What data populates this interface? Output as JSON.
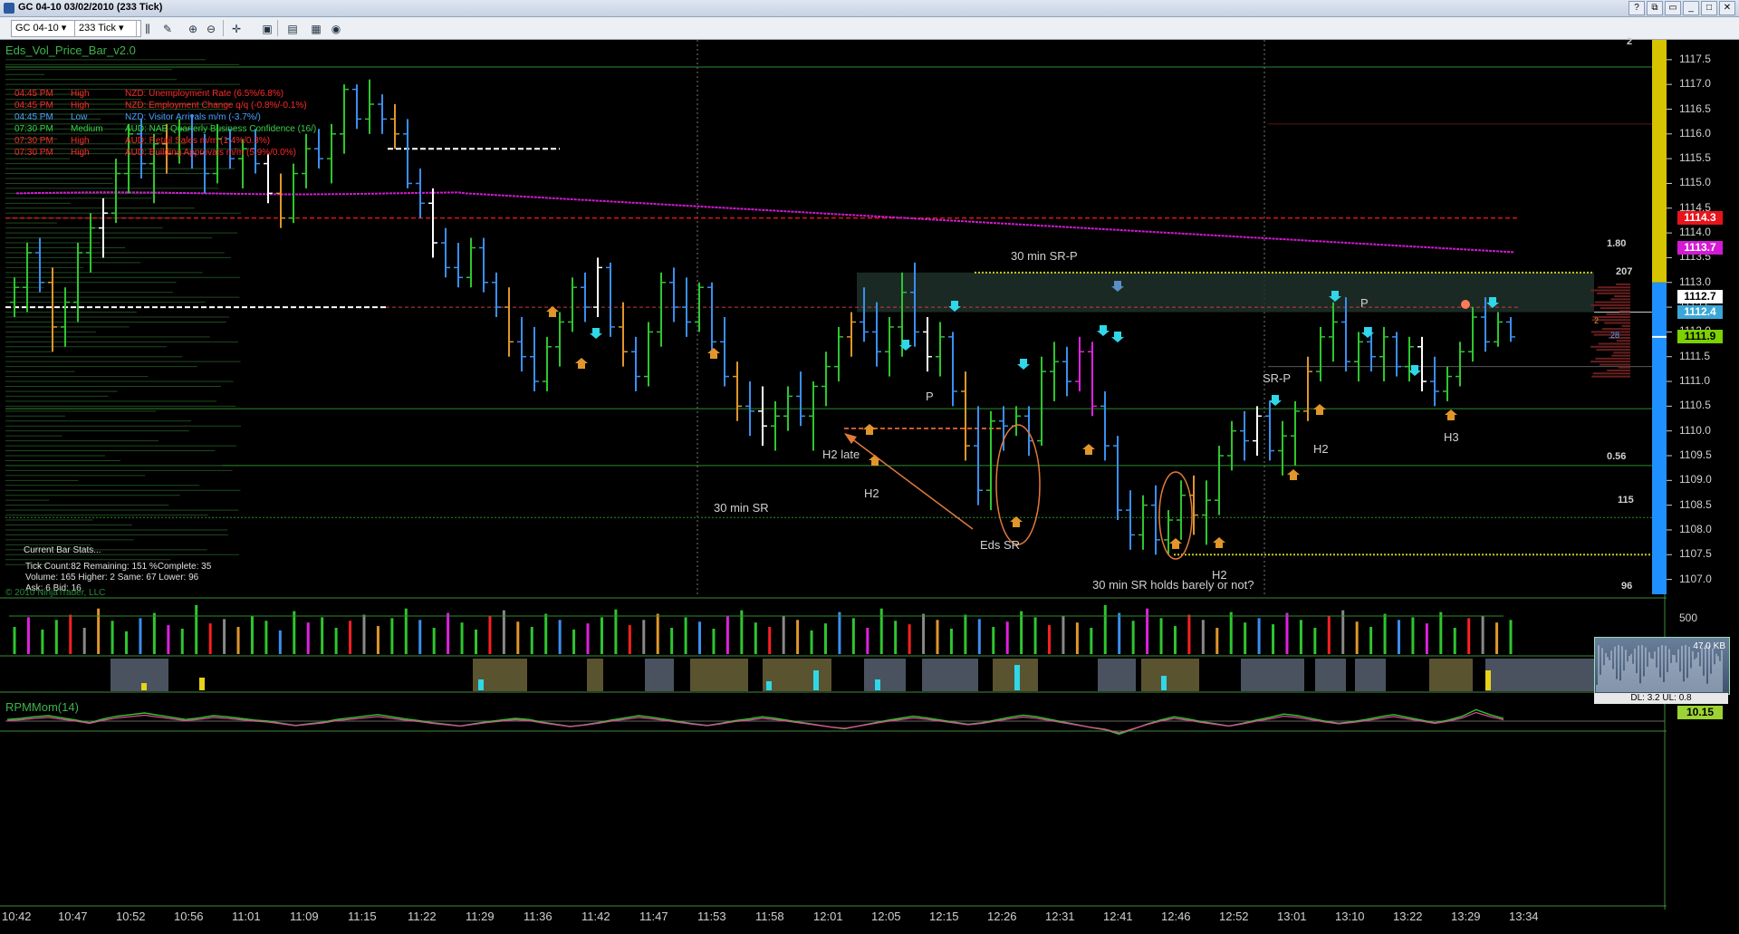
{
  "window": {
    "title": "GC 04-10  03/02/2010 (233 Tick)",
    "buttons": [
      "?",
      "⧉",
      "▭",
      "_",
      "□",
      "✕"
    ]
  },
  "toolbar": {
    "instrument": "GC 04-10",
    "interval": "233 Tick"
  },
  "indicators": {
    "top": "Eds_Vol_Price_Bar_v2.0",
    "bottom": "RPMMom(14)"
  },
  "news": [
    {
      "time": "04:45 PM",
      "impact": "High",
      "text": "NZD: Unemployment Rate (6.5%/6.8%)",
      "color": "#ff2a2a"
    },
    {
      "time": "04:45 PM",
      "impact": "High",
      "text": "NZD: Employment Change q/q (-0.8%/-0.1%)",
      "color": "#ff2a2a"
    },
    {
      "time": "04:45 PM",
      "impact": "Low",
      "text": "NZD: Visitor Arrivals m/m (-3.7%/)",
      "color": "#4aa3ff"
    },
    {
      "time": "07:30 PM",
      "impact": "Medium",
      "text": "AUD: NAB Quarterly Business Confidence (16/)",
      "color": "#39d24a"
    },
    {
      "time": "07:30 PM",
      "impact": "High",
      "text": "AUD: Retail Sales m/m (1.4%/0.3%)",
      "color": "#ff2a2a"
    },
    {
      "time": "07:30 PM",
      "impact": "High",
      "text": "AUD: Building Approvals m/m (5.9%/0.0%)",
      "color": "#ff2a2a"
    }
  ],
  "stats": {
    "header": "Current Bar Stats...",
    "line1": "Tick Count:82  Remaining: 151  %Complete: 35",
    "line2": "Volume: 165  Higher: 2  Same: 67  Lower: 96",
    "line3": "Ask: 6  Bid: 16"
  },
  "copyright": "© 2010 NinjaTrader, LLC",
  "annotations": {
    "sr30_p": "30 min SR-P",
    "sr30": "30 min SR",
    "eds_sr": "Eds SR",
    "h2_late": "H2 late",
    "h2_a": "H2",
    "h2_b": "H2",
    "h2_c": "H2",
    "h3": "H3",
    "p_a": "P",
    "p_b": "P",
    "sr_p": "SR-P",
    "holds": "30 min SR holds barely or not?"
  },
  "side_numbers": {
    "n2_top": "2",
    "n180": "1.80",
    "n207": "207",
    "n056": "0.56",
    "n115": "115",
    "n96": "96",
    "n2_mid": "2",
    "n28": "28"
  },
  "chart_data": {
    "type": "bar",
    "title": "GC 04-10 03/02/2010 (233 Tick)",
    "y_ticks": [
      "1117.5",
      "1117.0",
      "1116.5",
      "1116.0",
      "1115.5",
      "1115.0",
      "1114.5",
      "1114.0",
      "1113.5",
      "1113.0",
      "1112.5",
      "1112.0",
      "1111.5",
      "1111.0",
      "1110.5",
      "1110.0",
      "1109.5",
      "1109.0",
      "1108.5",
      "1108.0",
      "1107.5",
      "1107.0"
    ],
    "ylim": [
      1106.7,
      1117.9
    ],
    "x_labels": [
      "10:42",
      "10:47",
      "10:52",
      "10:56",
      "11:01",
      "11:09",
      "11:15",
      "11:22",
      "11:29",
      "11:36",
      "11:42",
      "11:47",
      "11:53",
      "11:58",
      "12:01",
      "12:05",
      "12:15",
      "12:26",
      "12:31",
      "12:41",
      "12:46",
      "12:52",
      "13:01",
      "13:10",
      "13:22",
      "13:29",
      "13:34"
    ],
    "price_tags": [
      {
        "value": "1114.3",
        "bg": "#e8141b",
        "fg": "#ffffff"
      },
      {
        "value": "1113.7",
        "bg": "#d41ad4",
        "fg": "#ffffff"
      },
      {
        "value": "1112.7",
        "bg": "#ffffff",
        "fg": "#000000"
      },
      {
        "value": "1112.4",
        "bg": "#3aa7d8",
        "fg": "#ffffff"
      },
      {
        "value": "1111.9",
        "bg": "#7cd100",
        "fg": "#000000"
      }
    ],
    "volume_axis_label": "500",
    "mini_panel": {
      "value": "47.0 KB",
      "footer": "DL: 3.2  UL: 0.8"
    },
    "momentum_value": "10.15",
    "colors": {
      "up": "#2ec62e",
      "down": "#3a8ff0",
      "neutral": "#ffffff",
      "warn": "#e0962a",
      "magenta": "#e020e0",
      "red": "#ff2020",
      "sma": "#d21ad2",
      "resistance": "#e8141b"
    },
    "levels": {
      "red_line": 1114.3,
      "white_dash_left": 1112.5,
      "yellow_top": 1113.2,
      "yellow_low": 1107.5,
      "white_dash_top": 1115.7
    },
    "bars": [
      {
        "o": 1112.6,
        "h": 1113.1,
        "l": 1112.3,
        "c": 1112.9
      },
      {
        "o": 1112.9,
        "h": 1113.8,
        "l": 1112.4,
        "c": 1113.6
      },
      {
        "o": 1113.6,
        "h": 1113.9,
        "l": 1112.8,
        "c": 1113.0
      },
      {
        "o": 1113.0,
        "h": 1113.3,
        "l": 1111.6,
        "c": 1112.1
      },
      {
        "o": 1112.1,
        "h": 1112.9,
        "l": 1111.7,
        "c": 1112.6
      },
      {
        "o": 1112.6,
        "h": 1113.8,
        "l": 1112.2,
        "c": 1113.6
      },
      {
        "o": 1113.6,
        "h": 1114.4,
        "l": 1113.2,
        "c": 1114.1
      },
      {
        "o": 1114.1,
        "h": 1114.7,
        "l": 1113.5,
        "c": 1114.4
      },
      {
        "o": 1114.4,
        "h": 1115.5,
        "l": 1114.2,
        "c": 1115.2
      },
      {
        "o": 1115.2,
        "h": 1116.2,
        "l": 1114.8,
        "c": 1116.0
      },
      {
        "o": 1116.0,
        "h": 1116.3,
        "l": 1115.1,
        "c": 1115.4
      },
      {
        "o": 1115.4,
        "h": 1116.0,
        "l": 1114.6,
        "c": 1115.8
      },
      {
        "o": 1115.8,
        "h": 1116.2,
        "l": 1115.2,
        "c": 1115.6
      },
      {
        "o": 1115.6,
        "h": 1116.3,
        "l": 1115.4,
        "c": 1116.1
      },
      {
        "o": 1116.1,
        "h": 1116.4,
        "l": 1115.3,
        "c": 1115.6
      },
      {
        "o": 1115.6,
        "h": 1116.0,
        "l": 1114.8,
        "c": 1115.2
      },
      {
        "o": 1115.2,
        "h": 1116.2,
        "l": 1115.0,
        "c": 1115.9
      },
      {
        "o": 1115.9,
        "h": 1116.1,
        "l": 1115.3,
        "c": 1115.5
      },
      {
        "o": 1115.5,
        "h": 1115.9,
        "l": 1114.9,
        "c": 1115.7
      },
      {
        "o": 1115.7,
        "h": 1116.1,
        "l": 1115.2,
        "c": 1115.4
      },
      {
        "o": 1115.4,
        "h": 1115.6,
        "l": 1114.6,
        "c": 1114.8
      },
      {
        "o": 1114.8,
        "h": 1115.2,
        "l": 1114.1,
        "c": 1114.3
      },
      {
        "o": 1114.3,
        "h": 1115.4,
        "l": 1114.2,
        "c": 1115.2
      },
      {
        "o": 1115.2,
        "h": 1116.0,
        "l": 1114.9,
        "c": 1115.7
      },
      {
        "o": 1115.7,
        "h": 1116.1,
        "l": 1115.3,
        "c": 1115.5
      },
      {
        "o": 1115.5,
        "h": 1116.2,
        "l": 1115.0,
        "c": 1116.0
      },
      {
        "o": 1116.0,
        "h": 1117.0,
        "l": 1115.6,
        "c": 1116.9
      },
      {
        "o": 1116.9,
        "h": 1117.0,
        "l": 1116.1,
        "c": 1116.3
      },
      {
        "o": 1116.3,
        "h": 1117.1,
        "l": 1116.0,
        "c": 1116.6
      },
      {
        "o": 1116.6,
        "h": 1116.8,
        "l": 1116.0,
        "c": 1116.3
      },
      {
        "o": 1116.3,
        "h": 1116.6,
        "l": 1115.7,
        "c": 1116.0
      },
      {
        "o": 1116.0,
        "h": 1116.3,
        "l": 1114.9,
        "c": 1115.0
      },
      {
        "o": 1115.0,
        "h": 1115.3,
        "l": 1114.3,
        "c": 1114.6
      },
      {
        "o": 1114.6,
        "h": 1114.9,
        "l": 1113.5,
        "c": 1113.8
      },
      {
        "o": 1113.8,
        "h": 1114.1,
        "l": 1113.1,
        "c": 1113.3
      },
      {
        "o": 1113.3,
        "h": 1113.8,
        "l": 1112.9,
        "c": 1113.1
      },
      {
        "o": 1113.1,
        "h": 1113.9,
        "l": 1112.9,
        "c": 1113.7
      },
      {
        "o": 1113.7,
        "h": 1113.9,
        "l": 1112.8,
        "c": 1113.0
      },
      {
        "o": 1113.0,
        "h": 1113.2,
        "l": 1112.3,
        "c": 1112.5
      },
      {
        "o": 1112.5,
        "h": 1112.9,
        "l": 1111.5,
        "c": 1111.8
      },
      {
        "o": 1111.8,
        "h": 1112.3,
        "l": 1111.2,
        "c": 1111.5
      },
      {
        "o": 1111.5,
        "h": 1112.1,
        "l": 1110.8,
        "c": 1111.0
      },
      {
        "o": 1111.0,
        "h": 1111.9,
        "l": 1110.8,
        "c": 1111.7
      },
      {
        "o": 1111.7,
        "h": 1112.4,
        "l": 1111.3,
        "c": 1112.2
      },
      {
        "o": 1112.2,
        "h": 1113.1,
        "l": 1112.0,
        "c": 1112.9
      },
      {
        "o": 1112.9,
        "h": 1113.2,
        "l": 1112.2,
        "c": 1112.5
      },
      {
        "o": 1112.5,
        "h": 1113.5,
        "l": 1112.3,
        "c": 1113.3
      },
      {
        "o": 1113.3,
        "h": 1113.4,
        "l": 1111.9,
        "c": 1112.1
      },
      {
        "o": 1112.1,
        "h": 1112.6,
        "l": 1111.3,
        "c": 1111.6
      },
      {
        "o": 1111.6,
        "h": 1111.9,
        "l": 1110.8,
        "c": 1111.1
      },
      {
        "o": 1111.1,
        "h": 1112.2,
        "l": 1110.9,
        "c": 1112.0
      },
      {
        "o": 1112.0,
        "h": 1113.2,
        "l": 1111.7,
        "c": 1113.0
      },
      {
        "o": 1113.0,
        "h": 1113.3,
        "l": 1112.2,
        "c": 1112.5
      },
      {
        "o": 1112.5,
        "h": 1113.1,
        "l": 1111.9,
        "c": 1112.2
      },
      {
        "o": 1112.2,
        "h": 1113.0,
        "l": 1112.0,
        "c": 1112.9
      },
      {
        "o": 1112.9,
        "h": 1113.0,
        "l": 1111.6,
        "c": 1111.8
      },
      {
        "o": 1111.8,
        "h": 1112.3,
        "l": 1110.9,
        "c": 1111.1
      },
      {
        "o": 1111.1,
        "h": 1111.4,
        "l": 1110.2,
        "c": 1110.5
      },
      {
        "o": 1110.5,
        "h": 1111.0,
        "l": 1109.9,
        "c": 1110.4
      },
      {
        "o": 1110.4,
        "h": 1110.9,
        "l": 1109.7,
        "c": 1110.1
      },
      {
        "o": 1110.1,
        "h": 1110.6,
        "l": 1109.6,
        "c": 1110.3
      },
      {
        "o": 1110.3,
        "h": 1110.9,
        "l": 1110.0,
        "c": 1110.7
      },
      {
        "o": 1110.7,
        "h": 1111.2,
        "l": 1110.1,
        "c": 1110.3
      },
      {
        "o": 1110.3,
        "h": 1111.0,
        "l": 1109.6,
        "c": 1110.9
      },
      {
        "o": 1110.9,
        "h": 1111.6,
        "l": 1110.5,
        "c": 1111.3
      },
      {
        "o": 1111.3,
        "h": 1112.1,
        "l": 1111.0,
        "c": 1111.9
      },
      {
        "o": 1111.9,
        "h": 1112.4,
        "l": 1111.5,
        "c": 1112.2
      },
      {
        "o": 1112.2,
        "h": 1112.9,
        "l": 1111.8,
        "c": 1112.0
      },
      {
        "o": 1112.0,
        "h": 1112.6,
        "l": 1111.3,
        "c": 1111.6
      },
      {
        "o": 1111.6,
        "h": 1112.3,
        "l": 1111.1,
        "c": 1112.1
      },
      {
        "o": 1112.1,
        "h": 1113.2,
        "l": 1111.5,
        "c": 1112.8
      },
      {
        "o": 1112.8,
        "h": 1113.4,
        "l": 1111.7,
        "c": 1112.0
      },
      {
        "o": 1112.0,
        "h": 1112.3,
        "l": 1111.2,
        "c": 1111.5
      },
      {
        "o": 1111.5,
        "h": 1112.2,
        "l": 1111.1,
        "c": 1111.9
      },
      {
        "o": 1111.9,
        "h": 1112.0,
        "l": 1110.5,
        "c": 1110.8
      },
      {
        "o": 1110.8,
        "h": 1111.2,
        "l": 1109.4,
        "c": 1109.7
      },
      {
        "o": 1109.7,
        "h": 1110.5,
        "l": 1108.5,
        "c": 1108.8
      },
      {
        "o": 1108.8,
        "h": 1110.4,
        "l": 1108.4,
        "c": 1110.2
      },
      {
        "o": 1110.2,
        "h": 1110.5,
        "l": 1109.6,
        "c": 1110.1
      },
      {
        "o": 1110.1,
        "h": 1110.5,
        "l": 1109.9,
        "c": 1110.3
      },
      {
        "o": 1110.3,
        "h": 1110.5,
        "l": 1109.5,
        "c": 1109.8
      },
      {
        "o": 1109.8,
        "h": 1111.5,
        "l": 1109.7,
        "c": 1111.2
      },
      {
        "o": 1111.2,
        "h": 1111.8,
        "l": 1110.6,
        "c": 1111.4
      },
      {
        "o": 1111.4,
        "h": 1111.7,
        "l": 1110.7,
        "c": 1111.0
      },
      {
        "o": 1111.0,
        "h": 1111.9,
        "l": 1110.8,
        "c": 1111.6
      },
      {
        "o": 1111.6,
        "h": 1111.8,
        "l": 1110.3,
        "c": 1110.5
      },
      {
        "o": 1110.5,
        "h": 1110.8,
        "l": 1109.4,
        "c": 1109.7
      },
      {
        "o": 1109.7,
        "h": 1109.9,
        "l": 1108.2,
        "c": 1108.4
      },
      {
        "o": 1108.4,
        "h": 1108.8,
        "l": 1107.6,
        "c": 1107.9
      },
      {
        "o": 1107.9,
        "h": 1108.7,
        "l": 1107.6,
        "c": 1108.5
      },
      {
        "o": 1108.5,
        "h": 1108.9,
        "l": 1107.5,
        "c": 1107.8
      },
      {
        "o": 1107.8,
        "h": 1108.4,
        "l": 1107.5,
        "c": 1108.2
      },
      {
        "o": 1108.2,
        "h": 1109.0,
        "l": 1107.8,
        "c": 1108.7
      },
      {
        "o": 1108.7,
        "h": 1109.1,
        "l": 1107.9,
        "c": 1108.3
      },
      {
        "o": 1108.3,
        "h": 1109.0,
        "l": 1107.7,
        "c": 1108.6
      },
      {
        "o": 1108.6,
        "h": 1109.7,
        "l": 1108.3,
        "c": 1109.5
      },
      {
        "o": 1109.5,
        "h": 1110.2,
        "l": 1109.2,
        "c": 1110.0
      },
      {
        "o": 1110.0,
        "h": 1110.4,
        "l": 1109.4,
        "c": 1109.8
      },
      {
        "o": 1109.8,
        "h": 1110.5,
        "l": 1109.5,
        "c": 1110.3
      },
      {
        "o": 1110.3,
        "h": 1110.6,
        "l": 1109.4,
        "c": 1109.6
      },
      {
        "o": 1109.6,
        "h": 1110.2,
        "l": 1109.1,
        "c": 1109.9
      },
      {
        "o": 1109.9,
        "h": 1110.6,
        "l": 1109.3,
        "c": 1110.4
      },
      {
        "o": 1110.4,
        "h": 1111.5,
        "l": 1110.2,
        "c": 1111.2
      },
      {
        "o": 1111.2,
        "h": 1112.1,
        "l": 1111.0,
        "c": 1111.9
      },
      {
        "o": 1111.9,
        "h": 1112.6,
        "l": 1111.4,
        "c": 1112.2
      },
      {
        "o": 1112.2,
        "h": 1112.7,
        "l": 1111.2,
        "c": 1111.4
      },
      {
        "o": 1111.4,
        "h": 1112.0,
        "l": 1111.0,
        "c": 1111.8
      },
      {
        "o": 1111.8,
        "h": 1112.1,
        "l": 1111.2,
        "c": 1111.5
      },
      {
        "o": 1111.5,
        "h": 1112.1,
        "l": 1111.0,
        "c": 1111.9
      },
      {
        "o": 1111.9,
        "h": 1112.0,
        "l": 1111.1,
        "c": 1111.3
      },
      {
        "o": 1111.3,
        "h": 1111.9,
        "l": 1111.0,
        "c": 1111.7
      },
      {
        "o": 1111.7,
        "h": 1111.9,
        "l": 1110.8,
        "c": 1111.0
      },
      {
        "o": 1111.0,
        "h": 1111.5,
        "l": 1110.5,
        "c": 1110.8
      },
      {
        "o": 1110.8,
        "h": 1111.3,
        "l": 1110.6,
        "c": 1111.1
      },
      {
        "o": 1111.1,
        "h": 1111.8,
        "l": 1110.9,
        "c": 1111.6
      },
      {
        "o": 1111.6,
        "h": 1112.5,
        "l": 1111.4,
        "c": 1112.3
      },
      {
        "o": 1112.3,
        "h": 1112.7,
        "l": 1111.6,
        "c": 1111.8
      },
      {
        "o": 1111.8,
        "h": 1112.4,
        "l": 1111.7,
        "c": 1112.2
      },
      {
        "o": 1112.2,
        "h": 1112.3,
        "l": 1111.8,
        "c": 1111.9
      }
    ],
    "volume": [
      310,
      420,
      280,
      390,
      450,
      300,
      520,
      380,
      260,
      410,
      470,
      330,
      290,
      560,
      350,
      400,
      310,
      440,
      380,
      270,
      490,
      360,
      420,
      300,
      380,
      450,
      320,
      410,
      520,
      390,
      300,
      470,
      360,
      280,
      430,
      500,
      370,
      310,
      460,
      390,
      280,
      350,
      420,
      510,
      330,
      390,
      460,
      300,
      420,
      370,
      290,
      440,
      500,
      360,
      310,
      430,
      390,
      270,
      350,
      480,
      410,
      300,
      520,
      380,
      340,
      460,
      390,
      290,
      450,
      400,
      310,
      370,
      490,
      420,
      330,
      440,
      360,
      300,
      560,
      470,
      380,
      520,
      410,
      320,
      450,
      390,
      300,
      480,
      360,
      410,
      340,
      470,
      390,
      300,
      430,
      500,
      370,
      310,
      460,
      390,
      420,
      350,
      480,
      300,
      410,
      440,
      360,
      390
    ],
    "momentum": [
      0.3,
      0.5,
      0.8,
      1.0,
      0.6,
      0.2,
      -0.3,
      0.4,
      0.9,
      1.2,
      1.5,
      1.1,
      0.7,
      0.3,
      0.6,
      1.0,
      0.8,
      0.5,
      0.2,
      0.0,
      -0.4,
      -0.8,
      -0.5,
      -0.2,
      0.3,
      0.6,
      0.9,
      1.2,
      0.8,
      0.4,
      0.1,
      -0.3,
      -0.6,
      -0.9,
      -0.5,
      -0.1,
      0.2,
      0.5,
      0.3,
      -0.2,
      -0.6,
      -1.0,
      -0.7,
      -0.3,
      0.2,
      0.6,
      1.0,
      0.7,
      0.3,
      -0.1,
      -0.5,
      -0.8,
      -0.4,
      0.1,
      0.4,
      0.8,
      0.5,
      0.1,
      -0.3,
      -0.7,
      -1.1,
      -1.4,
      -0.9,
      -0.4,
      0.1,
      0.5,
      0.9,
      0.6,
      0.2,
      -0.2,
      -0.6,
      -0.3,
      0.2,
      0.7,
      1.1,
      0.8,
      0.3,
      -0.2,
      -0.7,
      -1.2,
      -1.6,
      -2.4,
      -1.5,
      -0.6,
      0.2,
      0.8,
      0.4,
      -0.1,
      -0.5,
      -0.9,
      -0.4,
      0.2,
      0.7,
      1.3,
      1.0,
      0.5,
      0.0,
      -0.4,
      -0.1,
      0.3,
      0.8,
      1.2,
      0.7,
      0.2,
      -0.3,
      0.2,
      0.9,
      2.1,
      1.2,
      0.5
    ]
  }
}
